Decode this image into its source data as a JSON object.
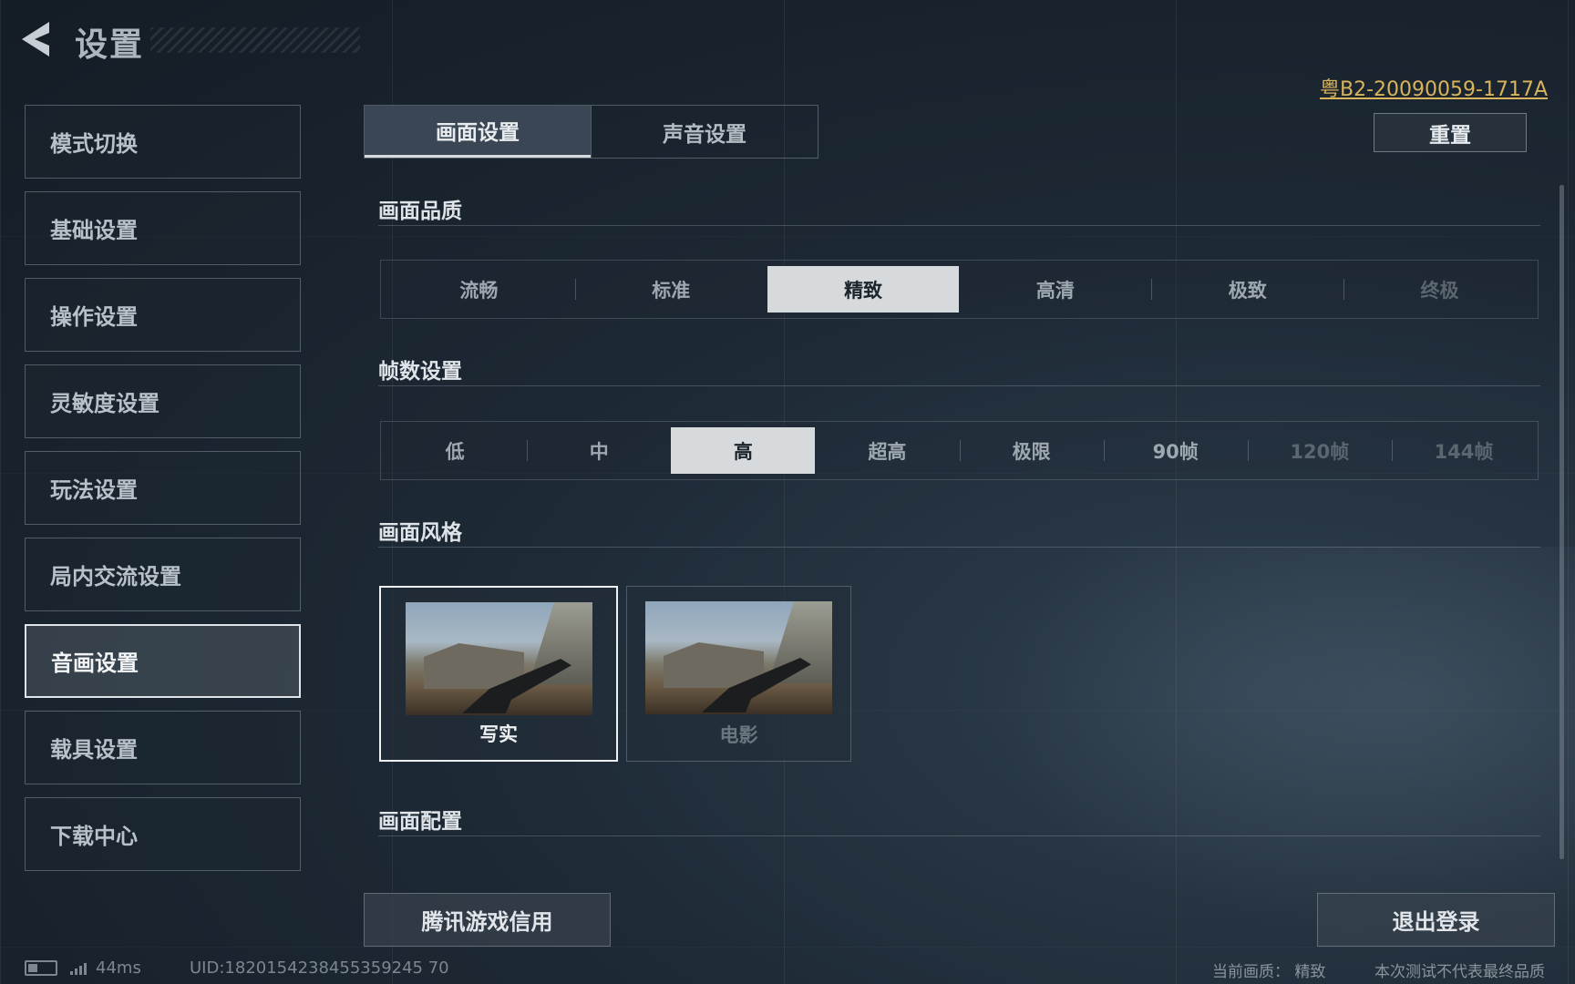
{
  "header": {
    "title": "设置",
    "license": "粤B2-20090059-1717A"
  },
  "sidebar": {
    "items": [
      {
        "label": "模式切换"
      },
      {
        "label": "基础设置"
      },
      {
        "label": "操作设置"
      },
      {
        "label": "灵敏度设置"
      },
      {
        "label": "玩法设置"
      },
      {
        "label": "局内交流设置"
      },
      {
        "label": "音画设置",
        "active": true
      },
      {
        "label": "载具设置"
      },
      {
        "label": "下载中心"
      }
    ]
  },
  "tabs": [
    {
      "label": "画面设置",
      "active": true
    },
    {
      "label": "声音设置"
    }
  ],
  "reset_label": "重置",
  "sections": {
    "quality": {
      "title": "画面品质",
      "options": [
        "流畅",
        "标准",
        "精致",
        "高清",
        "极致",
        "终极"
      ],
      "selected": "精致",
      "disabled": [
        "终极"
      ]
    },
    "framerate": {
      "title": "帧数设置",
      "options": [
        "低",
        "中",
        "高",
        "超高",
        "极限",
        "90帧",
        "120帧",
        "144帧"
      ],
      "selected": "高",
      "disabled": [
        "120帧",
        "144帧"
      ]
    },
    "style": {
      "title": "画面风格",
      "options": [
        {
          "label": "写实",
          "selected": true
        },
        {
          "label": "电影"
        }
      ]
    },
    "config": {
      "title": "画面配置"
    }
  },
  "buttons": {
    "credit": "腾讯游戏信用",
    "logout": "退出登录"
  },
  "status": {
    "ping": "44ms",
    "uid": "UID:1820154238455359245 70",
    "current_quality": "当前画质：  精致",
    "disclaimer": "本次测试不代表最终品质"
  },
  "colors": {
    "license": "#d9b45a",
    "selected_bg": "#d7dadc",
    "background": "#1d2935"
  }
}
